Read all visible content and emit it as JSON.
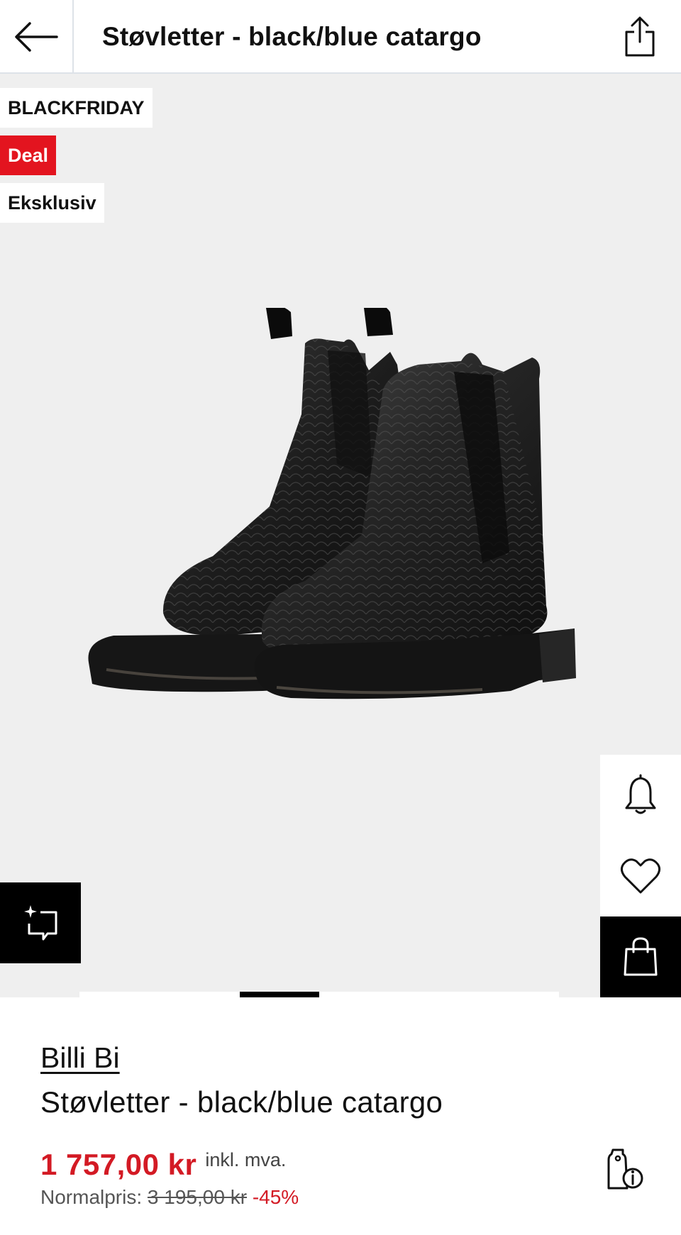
{
  "header": {
    "title": "Støvletter - black/blue catargo",
    "back_icon": "arrow-left-icon",
    "share_icon": "share-icon"
  },
  "gallery": {
    "badges": [
      "BLACKFRIDAY",
      "Deal",
      "Eksklusiv"
    ],
    "badge_colors": {
      "deal": "#e3141f"
    },
    "image": "black-chelsea-boots",
    "pager": {
      "current": 2,
      "total": 6
    },
    "actions": {
      "ai_icon": "sparkle-chat-icon",
      "alert_icon": "bell-icon",
      "wishlist_icon": "heart-icon",
      "cart_icon": "shopping-bag-icon"
    }
  },
  "product": {
    "brand": "Billi Bi",
    "name": "Støvletter - black/blue catargo",
    "price": "1 757,00 kr",
    "vat_note": "inkl. mva.",
    "normal_label": "Normalpris:",
    "normal_price": "3 195,00 kr",
    "discount": "-45%",
    "price_info_icon": "price-tag-info-icon",
    "price_color": "#d31a24"
  }
}
